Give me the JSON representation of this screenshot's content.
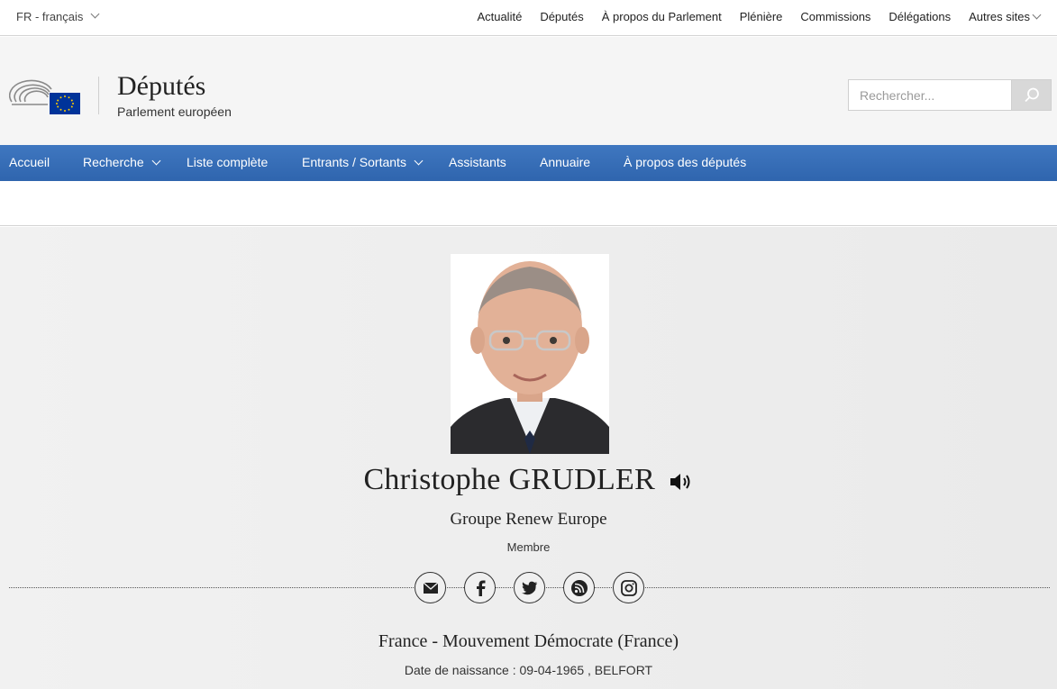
{
  "language": {
    "label": "FR - français"
  },
  "top_nav": [
    "Actualité",
    "Députés",
    "À propos du Parlement",
    "Plénière",
    "Commissions",
    "Délégations",
    "Autres sites"
  ],
  "header": {
    "title": "Députés",
    "subtitle": "Parlement européen"
  },
  "search": {
    "placeholder": "Rechercher..."
  },
  "main_nav": {
    "accueil": "Accueil",
    "recherche": "Recherche",
    "liste": "Liste complète",
    "entrants": "Entrants / Sortants",
    "assistants": "Assistants",
    "annuaire": "Annuaire",
    "apropos": "À propos des députés"
  },
  "profile": {
    "name": "Christophe GRUDLER",
    "group": "Groupe Renew Europe",
    "role": "Membre",
    "country_party": "France - Mouvement Démocrate (France)",
    "birth": "Date de naissance : 09-04-1965 , BELFORT"
  },
  "social_icons": [
    "email-icon",
    "facebook-icon",
    "twitter-icon",
    "blog-icon",
    "instagram-icon"
  ],
  "colors": {
    "nav_blue": "#3570b7",
    "eu_blue": "#003399",
    "eu_yellow": "#ffcc00"
  }
}
